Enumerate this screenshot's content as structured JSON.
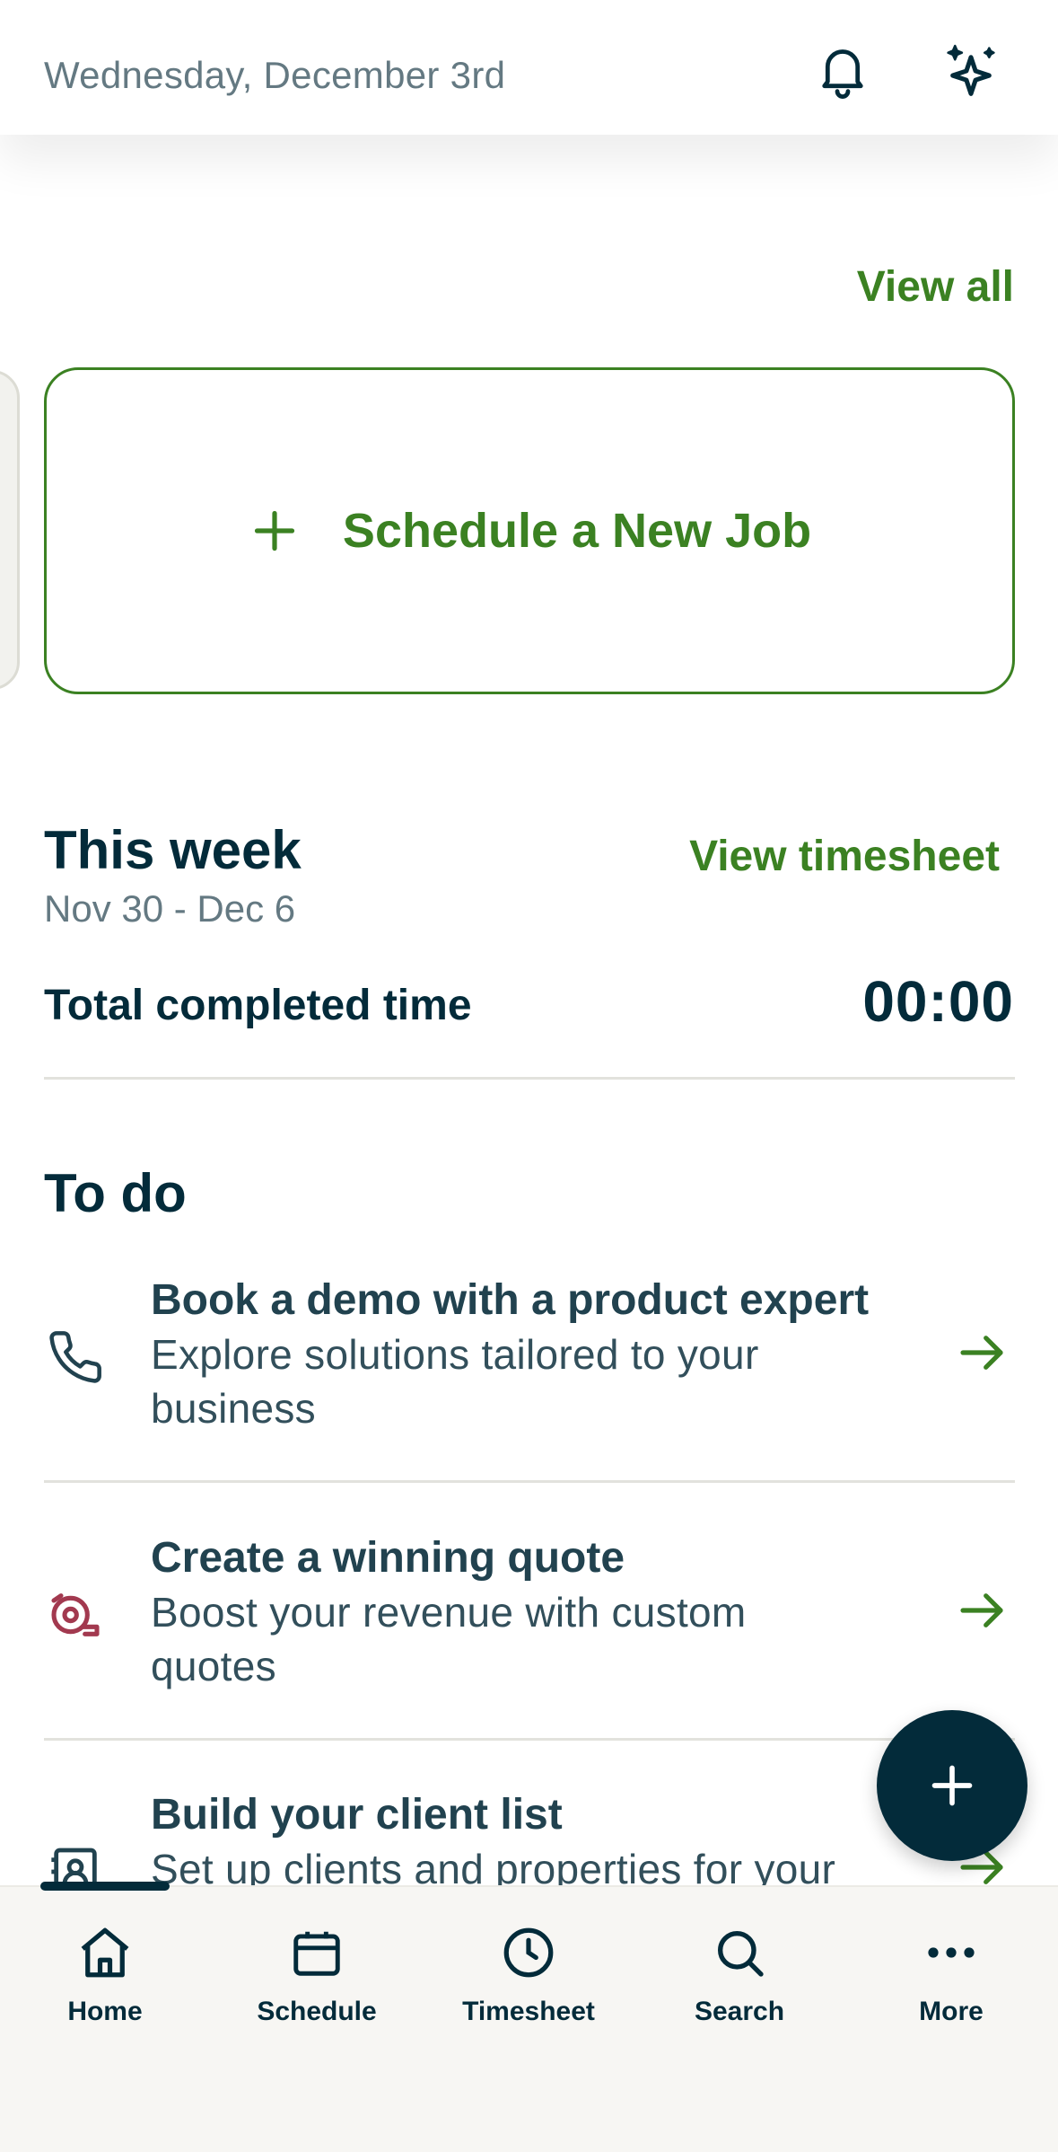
{
  "header": {
    "date": "Wednesday, December 3rd",
    "icons": [
      "bell-icon",
      "sparkles-icon"
    ]
  },
  "jobs": {
    "view_all_label": "View all",
    "schedule_new_job_label": "Schedule a New Job"
  },
  "this_week": {
    "title": "This week",
    "range": "Nov 30 - Dec 6",
    "view_timesheet_label": "View timesheet",
    "total_label": "Total completed time",
    "total_value": "00:00"
  },
  "todo": {
    "title": "To do",
    "items": [
      {
        "icon": "phone-icon",
        "title": "Book a demo with a product expert",
        "line1": "Explore solutions tailored to your",
        "line2": "business"
      },
      {
        "icon": "quote-icon",
        "title": "Create a winning quote",
        "line1": "Boost your revenue with custom",
        "line2": "quotes"
      },
      {
        "icon": "client-card-icon",
        "title": "Build your client list",
        "line1": "Set up clients and properties for your",
        "line2": ""
      }
    ]
  },
  "bottom_nav": {
    "items": [
      {
        "label": "Home",
        "icon": "home-icon"
      },
      {
        "label": "Schedule",
        "icon": "calendar-icon"
      },
      {
        "label": "Timesheet",
        "icon": "clock-icon"
      },
      {
        "label": "Search",
        "icon": "search-icon"
      },
      {
        "label": "More",
        "icon": "more-icon"
      }
    ]
  },
  "colors": {
    "brand_green": "#3b8122",
    "navy": "#032b3a",
    "muted": "#647982",
    "quote_icon": "#a2394f"
  }
}
